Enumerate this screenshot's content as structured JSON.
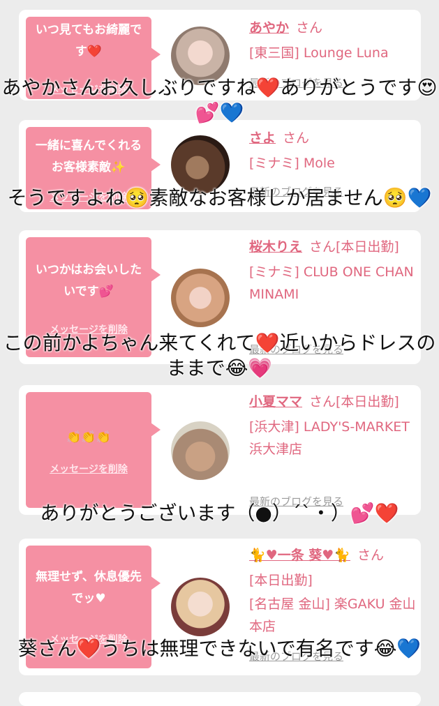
{
  "cards": [
    {
      "message": "いつ見てもお綺麗です❤️",
      "delete_label": "メッセージを削除",
      "name": "あやか",
      "honorific": "さん",
      "info_lines": [
        "[東三国] Lounge Luna"
      ],
      "blog_label": "最新のブログを見る"
    },
    {
      "message": "一緒に喜んでくれるお客様素敵✨",
      "delete_label": "メッセージを削除",
      "name": "さよ",
      "honorific": "さん",
      "info_lines": [
        "[ミナミ] Mole"
      ],
      "blog_label": "最新のブログを見る"
    },
    {
      "message": "いつかはお会いしたいです💕",
      "delete_label": "メッセージを削除",
      "name": "桜木りえ",
      "honorific": "さん[本日出勤]",
      "info_lines": [
        "[ミナミ] CLUB ONE CHAN MINAMI"
      ],
      "blog_label": "最新のブログを見る"
    },
    {
      "message": "👏👏👏",
      "delete_label": "メッセージを削除",
      "name": "小夏ママ",
      "honorific": "さん[本日出勤]",
      "info_lines": [
        "[浜大津] LADY'S-MARKET 浜大津店"
      ],
      "blog_label": "最新のブログを見る"
    },
    {
      "message": "無理せず、休息優先でッ♥",
      "delete_label": "メッセージを削除",
      "name": "🐈♥一条 葵♥🐈",
      "honorific": "さん",
      "info_lines": [
        "[本日出勤]",
        "[名古屋 金山] 楽GAKU 金山本店"
      ],
      "blog_label": "最新のブログを見る"
    }
  ],
  "captions": [
    "あやかさんお久しぶりですね❤️ありがとうです😍💕💙",
    "そうですよね🥺素敵なお客様しか居ません🥺💙",
    "この前かよちゃん来てくれて❤️近いからドレスのままで😂💗",
    "ありがとうございます（●）´`・）💕❤️",
    "葵さん❤️うちは無理できないで有名です😂💙"
  ],
  "colors": {
    "accent_pink": "#f590a3",
    "name_pink": "#e0677f",
    "background": "#ececec"
  }
}
